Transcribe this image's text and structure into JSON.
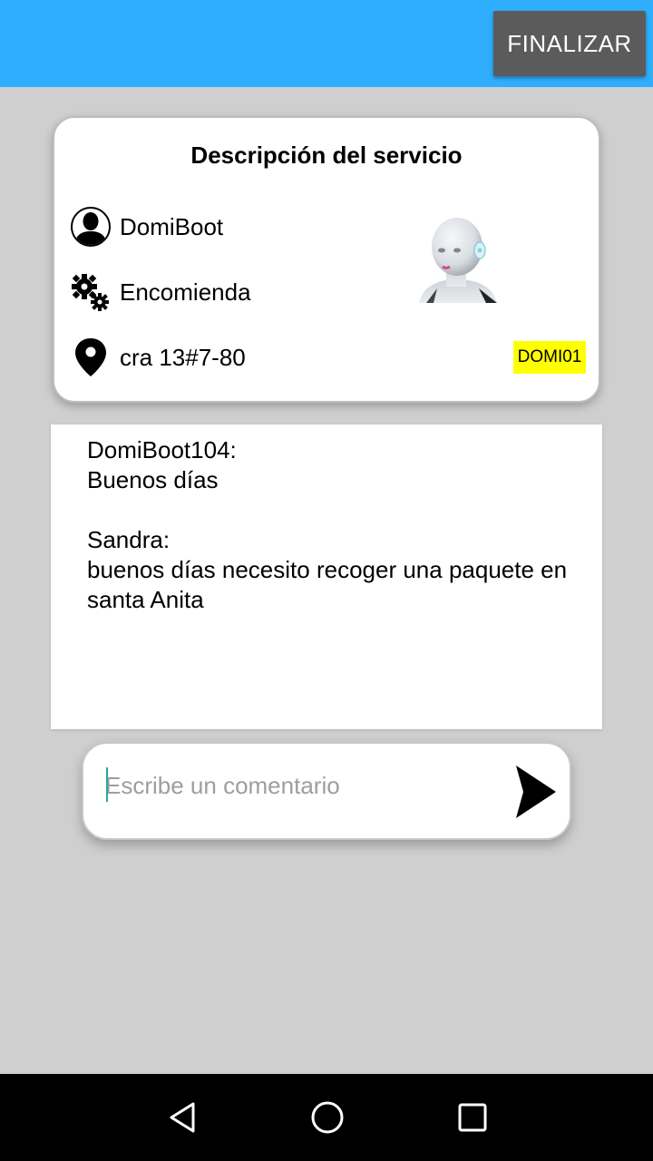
{
  "header": {
    "finish_label": "FINALIZAR"
  },
  "service": {
    "title": "Descripción del servicio",
    "user": {
      "icon": "user-icon",
      "label": "DomiBoot"
    },
    "type": {
      "icon": "gears-icon",
      "label": "Encomienda"
    },
    "address": {
      "icon": "location-pin-icon",
      "label": "cra 13#7-80"
    },
    "code": "DOMI01",
    "robot_image": "robot-head-image"
  },
  "chat": {
    "messages": [
      {
        "sender": "DomiBoot104:",
        "text": "Buenos días"
      },
      {
        "sender": "Sandra:",
        "text": "buenos días necesito recoger una paquete en santa Anita"
      }
    ]
  },
  "composer": {
    "placeholder": "Escribe un comentario",
    "value": "",
    "send_icon": "send-icon"
  },
  "navbar": {
    "back_icon": "back-triangle-icon",
    "home_icon": "home-circle-icon",
    "recents_icon": "recents-square-icon"
  },
  "colors": {
    "appbar": "#2faefd",
    "background": "#cfcfcf",
    "tag": "#ffff00",
    "caret": "#26a69a"
  }
}
